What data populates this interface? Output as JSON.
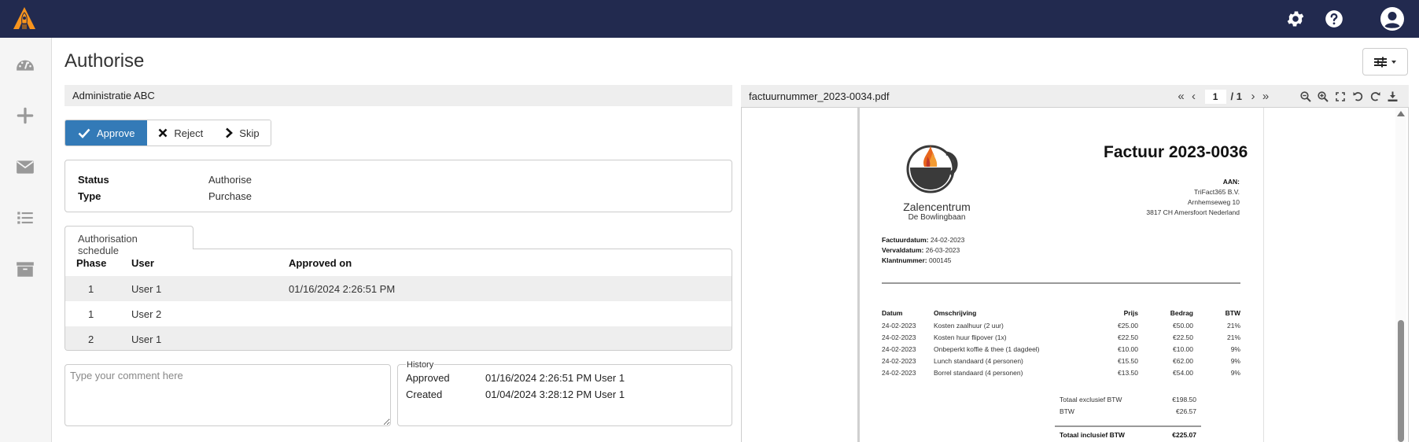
{
  "topbar": {
    "logo": "app-logo-rocket",
    "icons": [
      "gear-icon",
      "help-icon",
      "user-account-icon"
    ]
  },
  "sidebar": {
    "items": [
      {
        "icon": "dashboard-icon",
        "label": "Dashboard"
      },
      {
        "icon": "plus-icon",
        "label": "New"
      },
      {
        "icon": "envelope-icon",
        "label": "Inbox"
      },
      {
        "icon": "list-icon",
        "label": "List"
      },
      {
        "icon": "archive-icon",
        "label": "Archive"
      }
    ]
  },
  "page": {
    "title": "Authorise",
    "administration": "Administratie ABC"
  },
  "actions": {
    "approve": "Approve",
    "reject": "Reject",
    "skip": "Skip"
  },
  "info": {
    "status_label": "Status",
    "status_value": "Authorise",
    "type_label": "Type",
    "type_value": "Purchase"
  },
  "schedule": {
    "tab_label": "Authorisation schedule",
    "columns": [
      "Phase",
      "User",
      "Approved on"
    ],
    "rows": [
      {
        "phase": "1",
        "user": "User 1",
        "approved_on": "01/16/2024 2:26:51 PM"
      },
      {
        "phase": "1",
        "user": "User 2",
        "approved_on": ""
      },
      {
        "phase": "2",
        "user": "User 1",
        "approved_on": ""
      }
    ]
  },
  "comment": {
    "placeholder": "Type your comment here",
    "value": ""
  },
  "history": {
    "legend": "History",
    "entries": [
      {
        "action": "Approved",
        "detail": "01/16/2024 2:26:51 PM User 1"
      },
      {
        "action": "Created",
        "detail": "01/04/2024 3:28:12 PM User 1"
      }
    ]
  },
  "pdf": {
    "filename": "factuurnummer_2023-0034.pdf",
    "current_page": "1",
    "total_pages": "/ 1",
    "nav": {
      "first": "«",
      "prev": "‹",
      "next": "›",
      "last": "»"
    },
    "tools": [
      "zoom-out-icon",
      "zoom-in-icon",
      "fullscreen-icon",
      "rotate-left-icon",
      "rotate-right-icon",
      "download-icon"
    ]
  },
  "invoice": {
    "title": "Factuur 2023-0036",
    "to_label": "AAN:",
    "to_lines": [
      "TriFact365 B.V.",
      "Arnhemseweg 10",
      "3817 CH  Amersfoort Nederland"
    ],
    "brand_name": "Zalencentrum",
    "brand_sub": "De Bowlingbaan",
    "meta": [
      {
        "label": "Factuurdatum:",
        "value": "24-02-2023"
      },
      {
        "label": "Vervaldatum:",
        "value": "26-03-2023"
      },
      {
        "label": "Klantnummer:",
        "value": "000145"
      }
    ],
    "columns": [
      "Datum",
      "Omschrijving",
      "Prijs",
      "Bedrag",
      "BTW"
    ],
    "lines": [
      {
        "datum": "24-02-2023",
        "omschrijving": "Kosten zaalhuur (2 uur)",
        "prijs": "€25.00",
        "bedrag": "€50.00",
        "btw": "21%"
      },
      {
        "datum": "24-02-2023",
        "omschrijving": "Kosten huur flipover (1x)",
        "prijs": "€22.50",
        "bedrag": "€22.50",
        "btw": "21%"
      },
      {
        "datum": "24-02-2023",
        "omschrijving": "Onbeperkt koffie & thee (1 dagdeel)",
        "prijs": "€10.00",
        "bedrag": "€10.00",
        "btw": "9%"
      },
      {
        "datum": "24-02-2023",
        "omschrijving": "Lunch standaard (4 personen)",
        "prijs": "€15.50",
        "bedrag": "€62.00",
        "btw": "9%"
      },
      {
        "datum": "24-02-2023",
        "omschrijving": "Borrel standaard (4 personen)",
        "prijs": "€13.50",
        "bedrag": "€54.00",
        "btw": "9%"
      }
    ],
    "totals": {
      "excl_label": "Totaal exclusief BTW",
      "excl_value": "€198.50",
      "btw_label": "BTW",
      "btw_value": "€26.57",
      "incl_label": "Totaal inclusief BTW",
      "incl_value": "€225.07"
    }
  },
  "colors": {
    "topbar": "#222a4f",
    "primary": "#337ab7",
    "logo": "#f7941d"
  }
}
